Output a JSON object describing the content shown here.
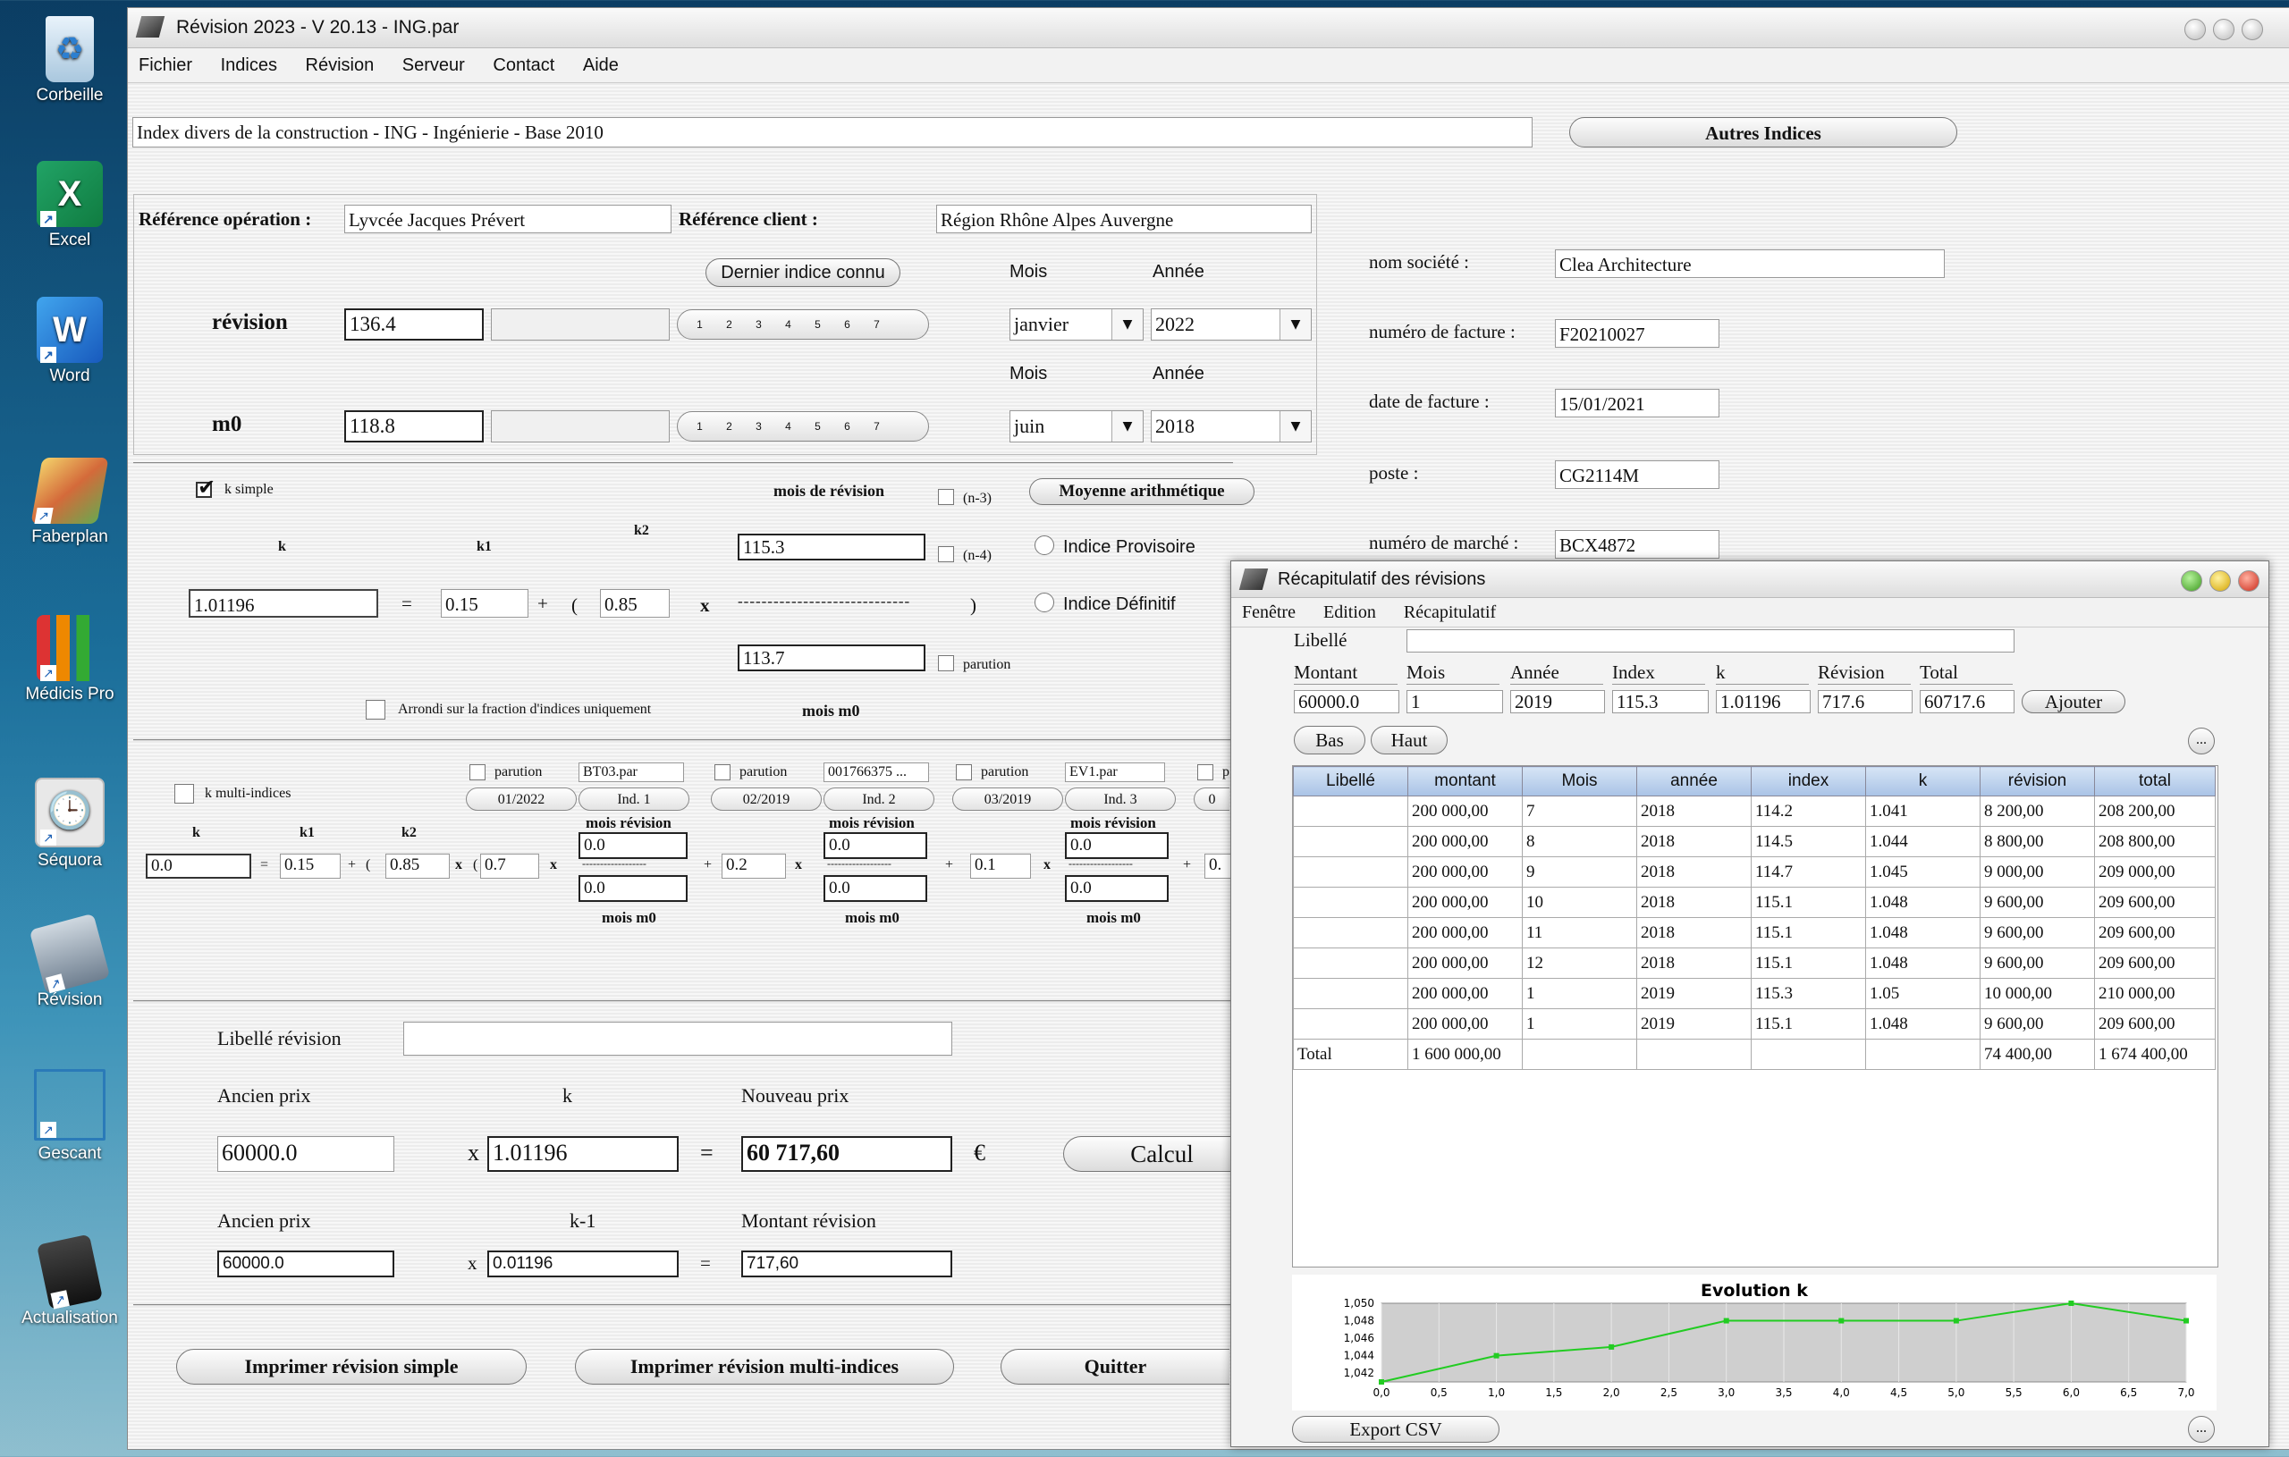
{
  "desktop": {
    "icons": [
      "Corbeille",
      "Excel",
      "Word",
      "Faberplan",
      "Médicis Pro",
      "Séquora",
      "Révision",
      "Gescant",
      "Actualisation"
    ]
  },
  "main": {
    "title": "Révision 2023 - V 20.13 - ING.par",
    "menu": [
      "Fichier",
      "Indices",
      "Révision",
      "Serveur",
      "Contact",
      "Aide"
    ],
    "index_title": "Index divers de la construction - ING - Ingénierie - Base 2010",
    "autres_indices": "Autres Indices",
    "ref_operation_label": "Référence opération :",
    "ref_operation": "Lyvcée Jacques Prévert",
    "ref_client_label": "Référence client :",
    "ref_client": "Région Rhône Alpes Auvergne",
    "dernier_indice": "Dernier indice connu",
    "mois_label": "Mois",
    "annee_label": "Année",
    "revision_label": "révision",
    "revision_value": "136.4",
    "revision_mois": "janvier",
    "revision_annee": "2022",
    "m0_label": "m0",
    "m0_value": "118.8",
    "m0_mois": "juin",
    "m0_annee": "2018",
    "stepper": [
      "1",
      "2",
      "3",
      "4",
      "5",
      "6",
      "7"
    ],
    "societe": {
      "nom_label": "nom société :",
      "nom": "Clea Architecture",
      "facture_label": "numéro de facture :",
      "facture": "F20210027",
      "date_label": "date de facture :",
      "date": "15/01/2021",
      "poste_label": "poste :",
      "poste": "CG2114M",
      "marche_label": "numéro de marché :",
      "marche": "BCX4872"
    },
    "k_simple": {
      "label": "k simple",
      "mois_revision": "mois de révision",
      "n3": "(n-3)",
      "n4": "(n-4)",
      "moyenne": "Moyenne arithmétique",
      "k": "k",
      "k1": "k1",
      "k2": "k2",
      "k_value": "1.01196",
      "k1_value": "0.15",
      "k2_value": "0.85",
      "num": "115.3",
      "den": "113.7",
      "eq": "=",
      "plus": "+",
      "lpar": "(",
      "x": "x",
      "rpar": ")",
      "dashes": "-----------------------------",
      "indice_provisoire": "Indice Provisoire",
      "indice_definitif": "Indice Définitif",
      "parution": "parution",
      "arrondi": "Arrondi sur la fraction d'indices uniquement",
      "mois_m0": "mois m0"
    },
    "k_multi": {
      "label": "k multi-indices",
      "parution": "parution",
      "files": [
        "BT03.par",
        "001766375 ...",
        "EV1.par"
      ],
      "dates": [
        "01/2022",
        "02/2019",
        "03/2019"
      ],
      "inds": [
        "Ind. 1",
        "Ind. 2",
        "Ind. 3"
      ],
      "p_trunc": "p",
      "d_trunc": "0",
      "k": "k",
      "k1": "k1",
      "k2": "k2",
      "k_value": "0.0",
      "k1_value": "0.15",
      "k2_value": "0.85",
      "c1": "0.7",
      "c2": "0.2",
      "c3": "0.1",
      "c4_trunc": "0.",
      "mois_revision": "mois révision",
      "mois_m0": "mois m0",
      "frac_value": "0.0",
      "dashes": "------------------",
      "eq": "=",
      "plus": "+",
      "lpar": "(",
      "x": "x"
    },
    "calc": {
      "libelle_label": "Libellé révision",
      "libelle_value": "",
      "ancien_prix_label": "Ancien prix",
      "k_label": "k",
      "nouveau_prix_label": "Nouveau prix",
      "ancien_prix": "60000.0",
      "k_value": "1.01196",
      "nouveau_prix": "60 717,60",
      "x": "x",
      "eq": "=",
      "euro": "€",
      "calcul": "Calcul",
      "km1_label": "k-1",
      "montant_revision_label": "Montant révision",
      "ancien_prix2": "60000.0",
      "km1_value": "0.01196",
      "montant_revision": "717,60"
    },
    "buttons": {
      "imprimer_simple": "Imprimer révision simple",
      "imprimer_multi": "Imprimer révision multi-indices",
      "quitter": "Quitter"
    }
  },
  "recap": {
    "title": "Récapitulatif des révisions",
    "menu": [
      "Fenêtre",
      "Edition",
      "Récapitulatif"
    ],
    "libelle_label": "Libellé",
    "form_labels": [
      "Montant",
      "Mois",
      "Année",
      "Index",
      "k",
      "Révision",
      "Total"
    ],
    "form_values": [
      "60000.0",
      "1",
      "2019",
      "115.3",
      "1.01196",
      "717.6",
      "60717.6"
    ],
    "ajouter": "Ajouter",
    "bas": "Bas",
    "haut": "Haut",
    "more": "...",
    "table": {
      "headers": [
        "Libellé",
        "montant",
        "Mois",
        "année",
        "index",
        "k",
        "révision",
        "total"
      ],
      "rows": [
        [
          "",
          "200 000,00",
          "7",
          "2018",
          "114.2",
          "1.041",
          "8 200,00",
          "208 200,00"
        ],
        [
          "",
          "200 000,00",
          "8",
          "2018",
          "114.5",
          "1.044",
          "8 800,00",
          "208 800,00"
        ],
        [
          "",
          "200 000,00",
          "9",
          "2018",
          "114.7",
          "1.045",
          "9 000,00",
          "209 000,00"
        ],
        [
          "",
          "200 000,00",
          "10",
          "2018",
          "115.1",
          "1.048",
          "9 600,00",
          "209 600,00"
        ],
        [
          "",
          "200 000,00",
          "11",
          "2018",
          "115.1",
          "1.048",
          "9 600,00",
          "209 600,00"
        ],
        [
          "",
          "200 000,00",
          "12",
          "2018",
          "115.1",
          "1.048",
          "9 600,00",
          "209 600,00"
        ],
        [
          "",
          "200 000,00",
          "1",
          "2019",
          "115.3",
          "1.05",
          "10 000,00",
          "210 000,00"
        ],
        [
          "",
          "200 000,00",
          "1",
          "2019",
          "115.1",
          "1.048",
          "9 600,00",
          "209 600,00"
        ],
        [
          "Total",
          "1 600 000,00",
          "",
          "",
          "",
          "",
          "74 400,00",
          "1 674 400,00"
        ]
      ]
    },
    "export_csv": "Export CSV",
    "chart_data": {
      "type": "line",
      "title": "Evolution k",
      "x": [
        0,
        1,
        2,
        3,
        4,
        5,
        6,
        7
      ],
      "y": [
        1.041,
        1.044,
        1.045,
        1.048,
        1.048,
        1.048,
        1.05,
        1.048
      ],
      "xlim": [
        0,
        7
      ],
      "ylim": [
        1.041,
        1.05
      ],
      "xticks": [
        "0,0",
        "0,5",
        "1,0",
        "1,5",
        "2,0",
        "2,5",
        "3,0",
        "3,5",
        "4,0",
        "4,5",
        "5,0",
        "5,5",
        "6,0",
        "6,5",
        "7,0"
      ],
      "yticks": [
        "1,042",
        "1,044",
        "1,046",
        "1,048",
        "1,050"
      ],
      "color": "#22cc22",
      "grid": true
    }
  }
}
